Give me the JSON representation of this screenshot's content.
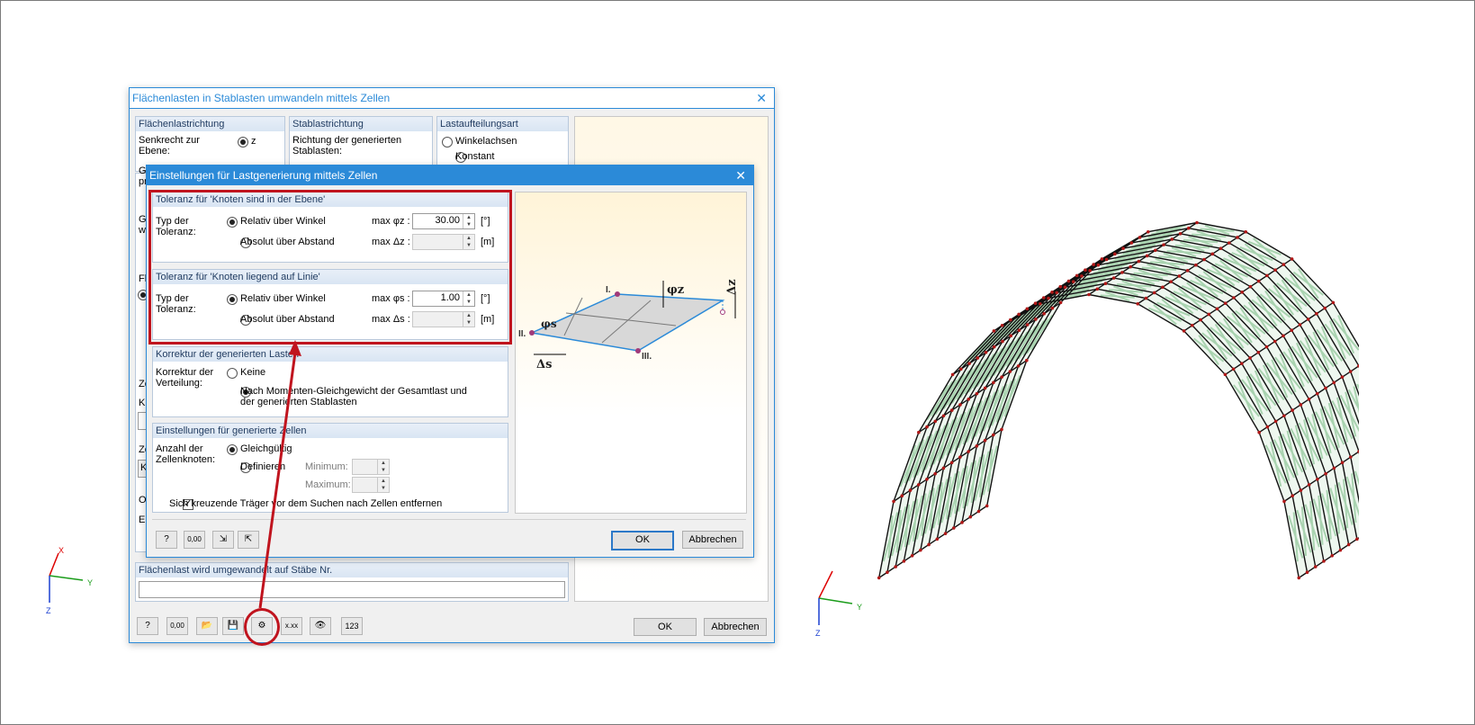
{
  "outer_dialog": {
    "title": "Flächenlasten in Stablasten umwandeln mittels Zellen",
    "col1_header": "Flächenlastrichtung",
    "col1_label": "Senkrecht zur Ebene:",
    "col1_option": "z",
    "col2_header": "Stablastrichtung",
    "col2_label": "Richtung der generierten Stablasten:",
    "col3_header": "Lastaufteilungsart",
    "col3_opt1": "Winkelachsen",
    "col3_opt2": "Konstant",
    "side_frag1": "Gl pr",
    "side_frag2": "Gl w",
    "side_frag3": "Fl",
    "side_frag4": "Ze",
    "side_frag5": "Kr",
    "side_frag6": "Ze",
    "side_frag7": "K",
    "side_frag8": "Ol",
    "side_frag9": "Ei",
    "bottom_group": "Flächenlast wird umgewandelt auf Stäbe Nr.",
    "ok": "OK",
    "cancel": "Abbrechen"
  },
  "inner_dialog": {
    "title": "Einstellungen für Lastgenerierung mittels Zellen",
    "g1": {
      "header": "Toleranz für 'Knoten sind in der Ebene'",
      "label": "Typ der Toleranz:",
      "opt1": "Relativ über Winkel",
      "opt2": "Absolut über Abstand",
      "max1": "max φz :",
      "val1": "30.00",
      "unit1": "[°]",
      "max2": "max Δz :",
      "unit2": "[m]"
    },
    "g2": {
      "header": "Toleranz für 'Knoten liegend auf Linie'",
      "label": "Typ der Toleranz:",
      "opt1": "Relativ über Winkel",
      "opt2": "Absolut über Abstand",
      "max1": "max φs :",
      "val1": "1.00",
      "unit1": "[°]",
      "max2": "max Δs :",
      "unit2": "[m]"
    },
    "g3": {
      "header": "Korrektur der generierten Lasten",
      "label": "Korrektur der Verteilung:",
      "opt1": "Keine",
      "opt2": "Nach Momenten-Gleichgewicht der Gesamtlast und der generierten Stablasten"
    },
    "g4": {
      "header": "Einstellungen für generierte Zellen",
      "label": "Anzahl der Zellenknoten:",
      "opt1": "Gleichgültig",
      "opt2": "Definieren",
      "min": "Minimum:",
      "max": "Maximum:",
      "check": "Sich kreuzende Träger vor dem Suchen nach Zellen entfernen"
    },
    "diagram": {
      "l1": "I.",
      "l2": "II.",
      "l3": "III.",
      "phiz": "φz",
      "phis": "φs",
      "dz": "Δz",
      "ds": "Δs"
    },
    "ok": "OK",
    "cancel": "Abbrechen"
  },
  "axes": {
    "x": "X",
    "y": "Y",
    "z": "Z"
  },
  "colors": {
    "accent": "#c0141e",
    "title_blue": "#2b8ad8",
    "mesh_green": "#a9d3b0"
  }
}
